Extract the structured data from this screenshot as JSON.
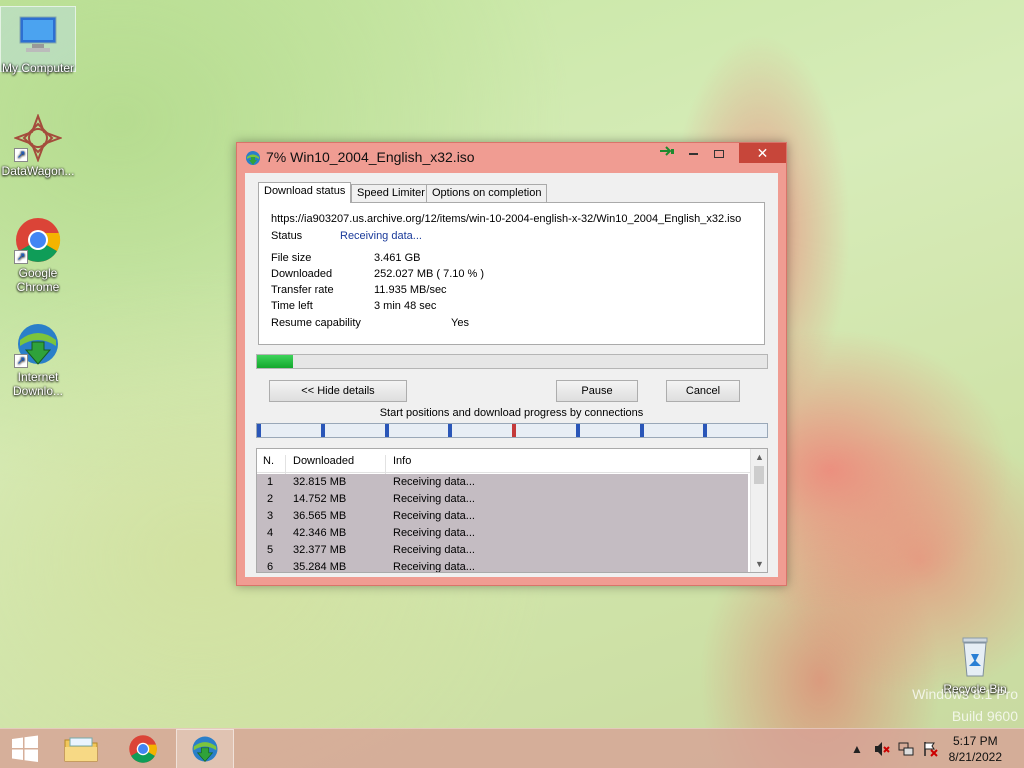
{
  "desktop": {
    "icons": [
      {
        "label": "My Computer",
        "icon": "computer-icon"
      },
      {
        "label": "DataWagon...",
        "icon": "datawagon-icon"
      },
      {
        "label": "Google Chrome",
        "icon": "chrome-icon"
      },
      {
        "label": "Internet Downlo...",
        "icon": "idm-icon"
      },
      {
        "label": "Recycle Bin",
        "icon": "recycle-bin-icon"
      }
    ],
    "watermark_line1": "Windows 8.1 Pro",
    "watermark_line2": "Build 9600"
  },
  "window": {
    "title": "7% Win10_2004_English_x32.iso",
    "tabs": [
      "Download status",
      "Speed Limiter",
      "Options on completion"
    ],
    "url": "https://ia903207.us.archive.org/12/items/win-10-2004-english-x-32/Win10_2004_English_x32.iso",
    "status_label": "Status",
    "status_value": "Receiving data...",
    "details": [
      {
        "label": "File size",
        "value": "3.461  GB"
      },
      {
        "label": "Downloaded",
        "value": "252.027  MB  ( 7.10 % )"
      },
      {
        "label": "Transfer rate",
        "value": "11.935  MB/sec"
      },
      {
        "label": "Time left",
        "value": "3 min 48 sec"
      },
      {
        "label": "Resume capability",
        "value": "Yes"
      }
    ],
    "progress_fraction": 0.071,
    "buttons": {
      "hide_details": "<< Hide details",
      "pause": "Pause",
      "cancel": "Cancel"
    },
    "connections_caption": "Start positions and download progress by connections",
    "connections_count": 8,
    "list_headers": [
      "N.",
      "Downloaded",
      "Info"
    ],
    "connections": [
      {
        "n": "1",
        "downloaded": "32.815  MB",
        "info": "Receiving data..."
      },
      {
        "n": "2",
        "downloaded": "14.752  MB",
        "info": "Receiving data..."
      },
      {
        "n": "3",
        "downloaded": "36.565  MB",
        "info": "Receiving data..."
      },
      {
        "n": "4",
        "downloaded": "42.346  MB",
        "info": "Receiving data..."
      },
      {
        "n": "5",
        "downloaded": "32.377  MB",
        "info": "Receiving data..."
      },
      {
        "n": "6",
        "downloaded": "35.284  MB",
        "info": "Receiving data..."
      }
    ]
  },
  "taskbar": {
    "time": "5:17 PM",
    "date": "8/21/2022"
  },
  "colors": {
    "window_frame": "#f09c92",
    "close_button": "#c7463a",
    "progress_green": "#14a82d",
    "row_highlight": "#c4bcc2",
    "connection_marker": "#2a56b8"
  }
}
